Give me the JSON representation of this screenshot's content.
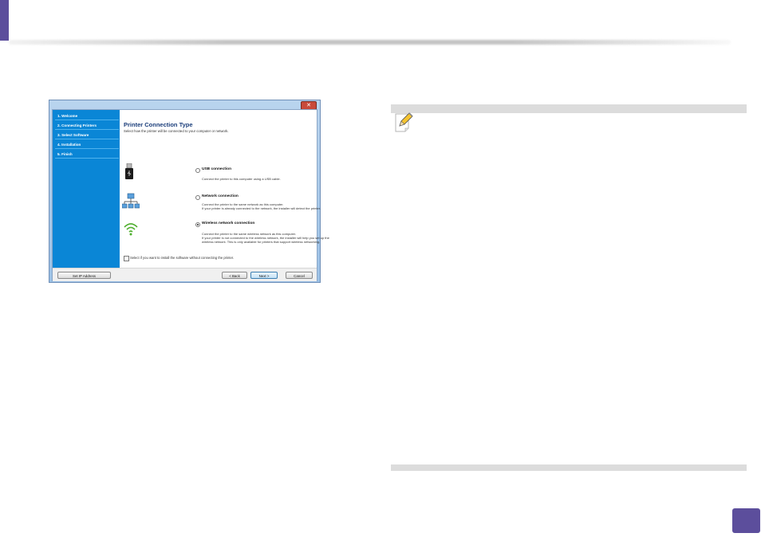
{
  "installer": {
    "close_glyph": "✕",
    "steps": [
      "1. Welcome",
      "2. Connecting Printers",
      "3. Select Software",
      "4. Installation",
      "5. Finish"
    ],
    "title": "Printer Connection Type",
    "subtitle": "Select how the printer will be connected to your computer or network.",
    "options": [
      {
        "label": "USB connection",
        "icon": "usb-icon",
        "selected": false,
        "desc": [
          "Connect the printer to this computer using a USB cable."
        ]
      },
      {
        "label": "Network connection",
        "icon": "network-icon",
        "selected": false,
        "desc": [
          "Connect the printer to the same network as this computer.",
          "If your printer is already connected to the network, the installer will detect the printer."
        ]
      },
      {
        "label": "Wireless network connection",
        "icon": "wifi-icon",
        "selected": true,
        "desc": [
          "Connect the printer to the same wireless network as this computer.",
          "If your printer is not connected to the wireless network, the installer will help you set up the",
          "wireless network. This is only available for printers that support wireless networking."
        ]
      }
    ],
    "checkbox_label": "Select if you want to install the software without connecting the printer.",
    "buttons": {
      "set_ip": "Set IP Address",
      "back": "< Back",
      "next": "Next >",
      "cancel": "Cancel"
    }
  },
  "colors": {
    "accent": "#5c4e9c",
    "sidebar": "#0a86d6",
    "note_bar": "#dcdcdc"
  }
}
